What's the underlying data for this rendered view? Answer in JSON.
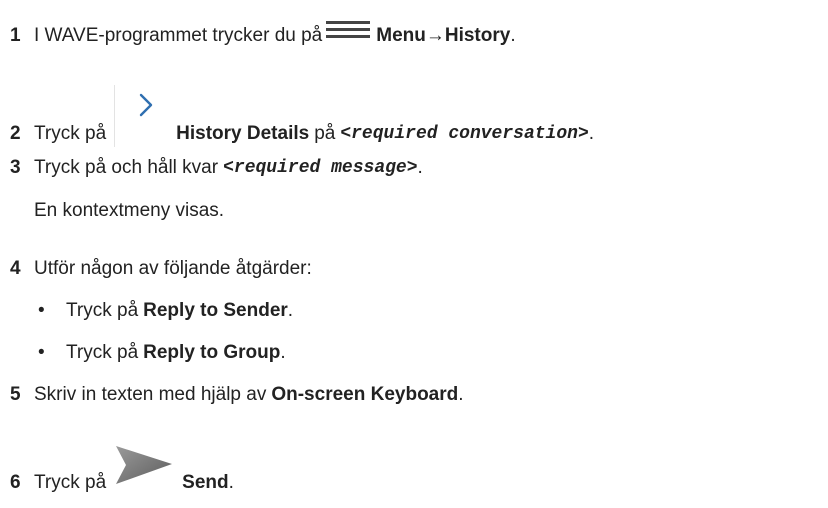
{
  "steps": [
    {
      "num": "1",
      "pre": "I WAVE-programmet trycker du på",
      "icon": "hamburger-menu-icon",
      "bold": "Menu",
      "arrow": "→",
      "bold2": "History",
      "post": "."
    },
    {
      "num": "2",
      "pre": "Tryck på",
      "icon": "chevron-right-icon",
      "bold": "History Details",
      "mid": "på",
      "mono": "<required conversation>",
      "post": "."
    },
    {
      "num": "3",
      "pre": "Tryck på och håll kvar",
      "mono": "<required message>",
      "post": ".",
      "result": "En kontextmeny visas."
    },
    {
      "num": "4",
      "pre": "Utför någon av följande åtgärder:",
      "bullets": [
        {
          "pre": "Tryck på",
          "bold": "Reply to Sender",
          "post": "."
        },
        {
          "pre": "Tryck på",
          "bold": "Reply to Group",
          "post": "."
        }
      ]
    },
    {
      "num": "5",
      "pre": "Skriv in texten med hjälp av",
      "bold": "On-screen Keyboard",
      "post": "."
    },
    {
      "num": "6",
      "pre": "Tryck på",
      "icon": "send-arrow-icon",
      "bold": "Send",
      "post": "."
    }
  ],
  "bullet_char": "•"
}
